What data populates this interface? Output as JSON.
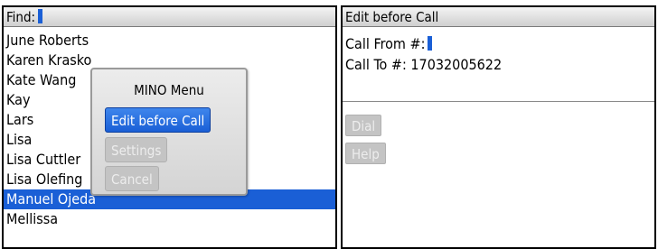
{
  "left_screen": {
    "find_label": "Find:",
    "contacts": [
      {
        "name": "June Roberts",
        "selected": false
      },
      {
        "name": "Karen Krasko",
        "selected": false
      },
      {
        "name": "Kate Wang",
        "selected": false
      },
      {
        "name": "Kay",
        "selected": false
      },
      {
        "name": "Lars",
        "selected": false
      },
      {
        "name": "Lisa",
        "selected": false
      },
      {
        "name": "Lisa Cuttler",
        "selected": false
      },
      {
        "name": "Lisa Olefing",
        "selected": false
      },
      {
        "name": "Manuel Ojeda",
        "selected": true
      },
      {
        "name": "Mellissa",
        "selected": false
      }
    ],
    "menu": {
      "title": "MINO Menu",
      "items": [
        {
          "label": "Edit before Call",
          "state": "active"
        },
        {
          "label": "Settings",
          "state": "disabled"
        },
        {
          "label": "Cancel",
          "state": "disabled"
        }
      ]
    }
  },
  "right_screen": {
    "title": "Edit before Call",
    "call_from_label": "Call From #:",
    "call_to_label": "Call To #:",
    "call_to_value": "17032005622",
    "buttons": {
      "dial": "Dial",
      "help": "Help"
    }
  },
  "colors": {
    "selection": "#1a5fd6",
    "disabled_button": "#c4c4c4"
  }
}
